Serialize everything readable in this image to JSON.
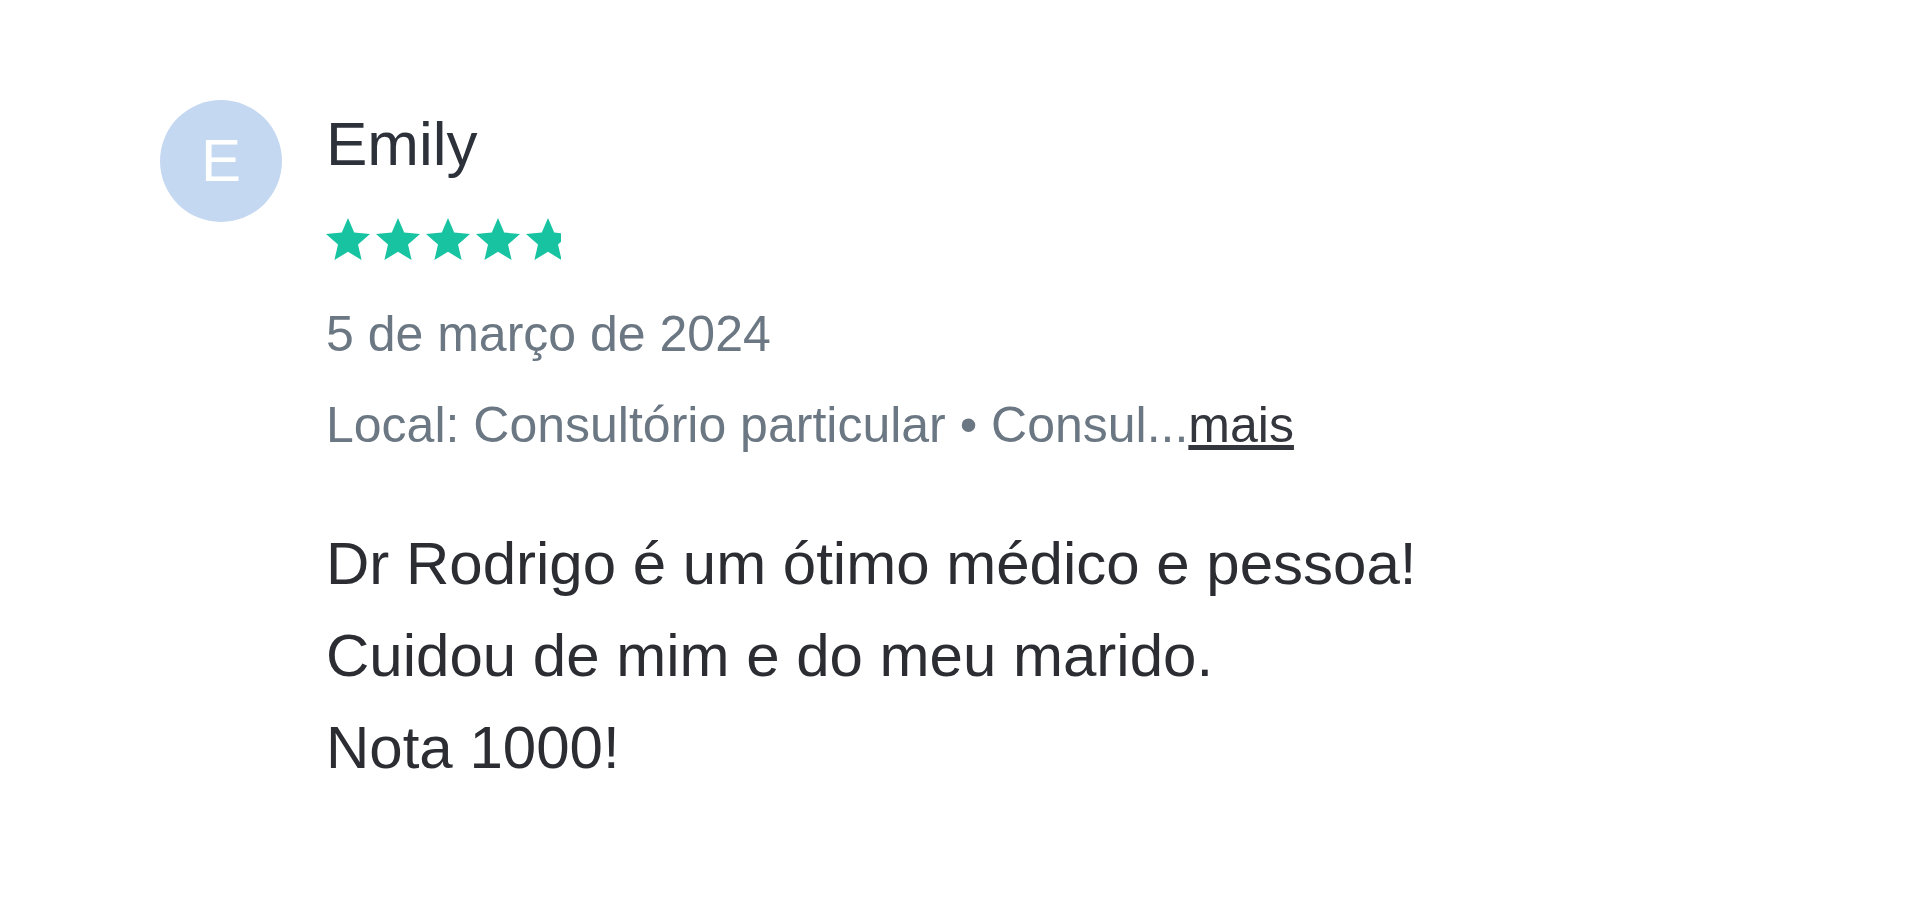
{
  "review": {
    "avatar": {
      "initial": "E"
    },
    "author": "Emily",
    "stars": 4.8,
    "date": "5 de março de 2024",
    "details": "Local: Consultório particular • Consul...",
    "more_link": "mais",
    "text_lines": [
      "Dr Rodrigo é um ótimo médico e pessoa!",
      "Cuidou de mim e do meu marido.",
      "Nota 1000!"
    ]
  }
}
